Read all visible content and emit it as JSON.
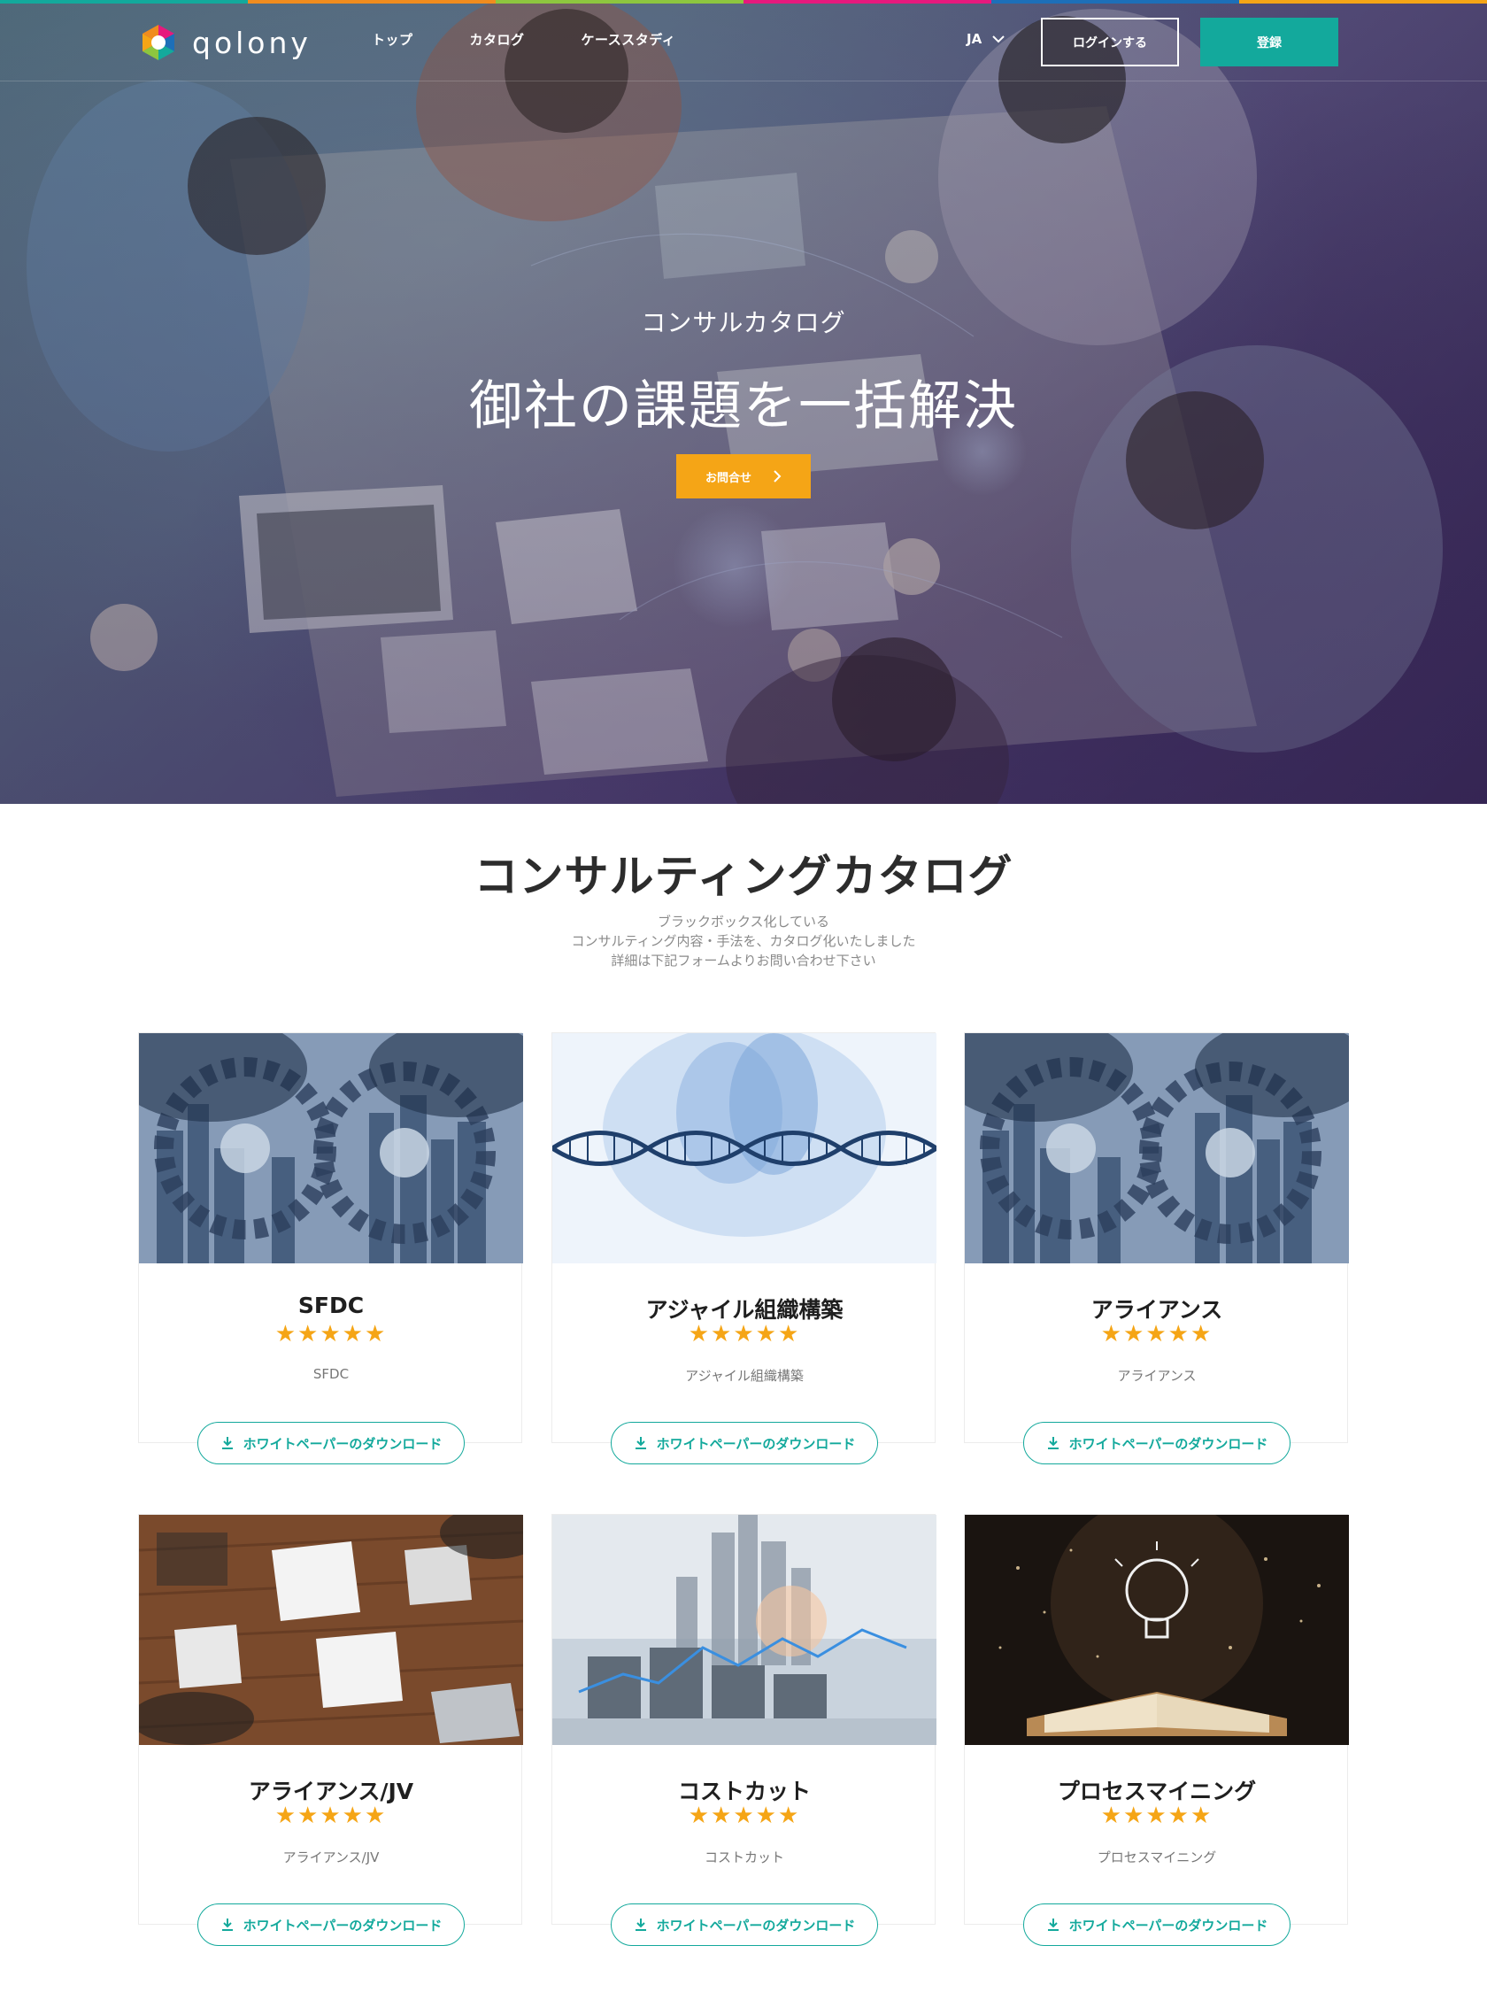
{
  "colors": {
    "accent_teal": "#13a99c",
    "accent_orange": "#f5a516",
    "strip": [
      "#13a99c",
      "#f08c1e",
      "#8dc63f",
      "#e6197d",
      "#1d6fb8",
      "#f5a516"
    ]
  },
  "header": {
    "logo_text": "qolony",
    "nav": [
      "トップ",
      "カタログ",
      "ケーススタディ"
    ],
    "language": "JA",
    "login_label": "ログインする",
    "register_label": "登録"
  },
  "hero": {
    "subtitle": "コンサルカタログ",
    "title": "御社の課題を一括解決",
    "cta_label": "お問合せ"
  },
  "catalog": {
    "title": "コンサルティングカタログ",
    "description": [
      "ブラックボックス化している",
      "コンサルティング内容・手法を、カタログ化いたしました",
      "詳細は下記フォームよりお問い合わせ下さい"
    ],
    "button_label": "ホワイトペーパーのダウンロード",
    "cards": [
      {
        "title": "SFDC",
        "rating": 5,
        "stars": "★★★★★",
        "desc": "SFDC",
        "image": "gears-city"
      },
      {
        "title": "アジャイル組織構築",
        "rating": 5,
        "stars": "★★★★★",
        "desc": "アジャイル組織構築",
        "image": "dna-runners"
      },
      {
        "title": "アライアンス",
        "rating": 5,
        "stars": "★★★★★",
        "desc": "アライアンス",
        "image": "gears-city"
      },
      {
        "title": "アライアンス/JV",
        "rating": 5,
        "stars": "★★★★★",
        "desc": "アライアンス/JV",
        "image": "meeting-table"
      },
      {
        "title": "コストカット",
        "rating": 5,
        "stars": "★★★★★",
        "desc": "コストカット",
        "image": "city-coins"
      },
      {
        "title": "プロセスマイニング",
        "rating": 5,
        "stars": "★★★★★",
        "desc": "プロセスマイニング",
        "image": "lightbulb-book"
      }
    ]
  }
}
